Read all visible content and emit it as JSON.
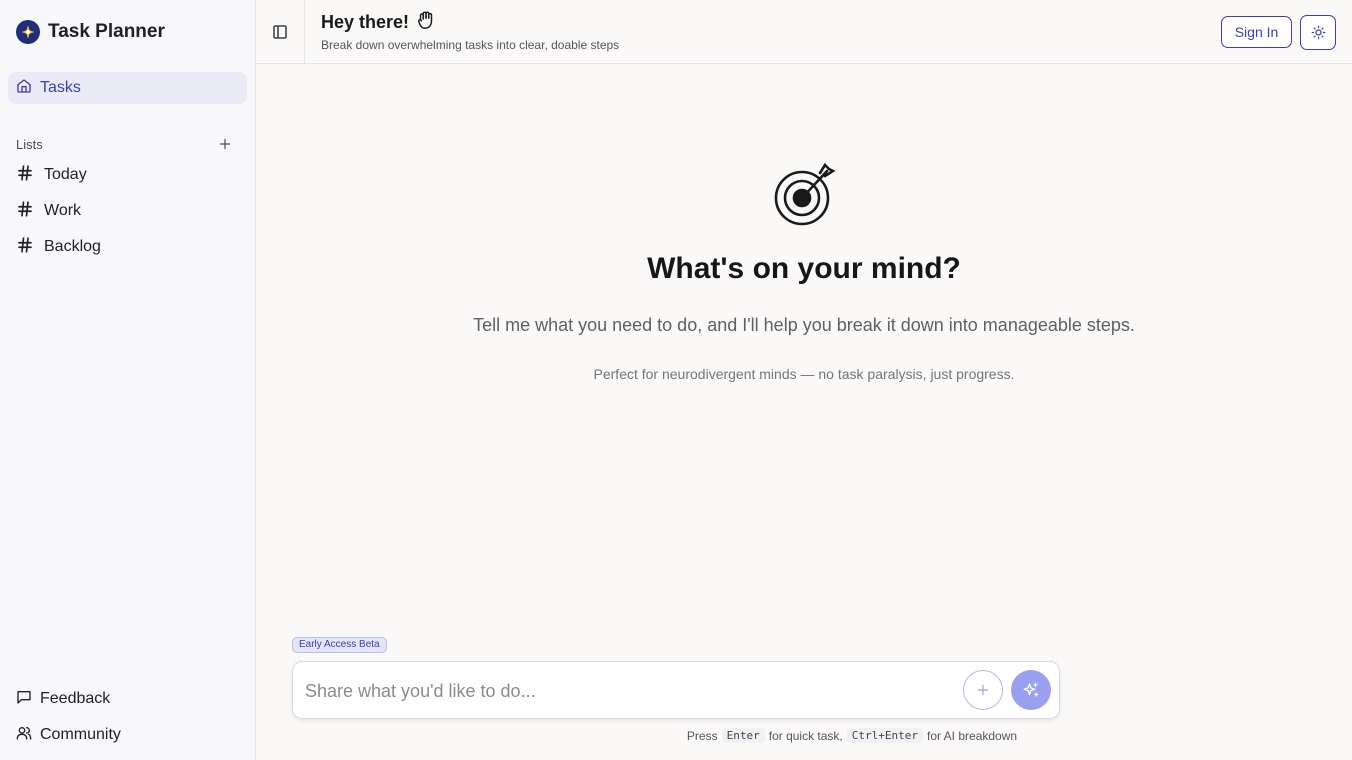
{
  "app": {
    "title": "Task Planner",
    "accent_color": "#3b3fb0",
    "logo_icon": "star-logo-icon"
  },
  "sidebar": {
    "nav": [
      {
        "label": "Tasks",
        "icon": "home-icon"
      }
    ],
    "lists_heading": "Lists",
    "lists_add_icon": "plus-icon",
    "lists": [
      {
        "label": "Today",
        "icon": "hash-icon"
      },
      {
        "label": "Work",
        "icon": "hash-icon"
      },
      {
        "label": "Backlog",
        "icon": "hash-icon"
      }
    ],
    "footer": [
      {
        "label": "Feedback",
        "icon": "message-square-icon"
      },
      {
        "label": "Community",
        "icon": "users-icon"
      }
    ]
  },
  "header": {
    "greeting": "Hey there!",
    "greeting_icon": "raised-fist-icon",
    "subtitle": "Break down overwhelming tasks into clear, doable steps",
    "sign_in_label": "Sign In",
    "theme_icon": "sun-icon"
  },
  "hero": {
    "icon": "target-dart-icon",
    "title": "What's on your mind?",
    "subtitle": "Tell me what you need to do, and I'll help you break it down into manageable steps.",
    "note": "Perfect for neurodivergent minds — no task paralysis, just progress."
  },
  "composer": {
    "badge": "Early Access Beta",
    "placeholder": "Share what you'd like to do...",
    "value": "",
    "add_icon": "plus-icon",
    "ai_icon": "sparkles-icon",
    "hint_press": "Press",
    "hint_key1": "Enter",
    "hint_mid": "for quick task,",
    "hint_key2": "Ctrl+Enter",
    "hint_end": "for AI breakdown"
  }
}
